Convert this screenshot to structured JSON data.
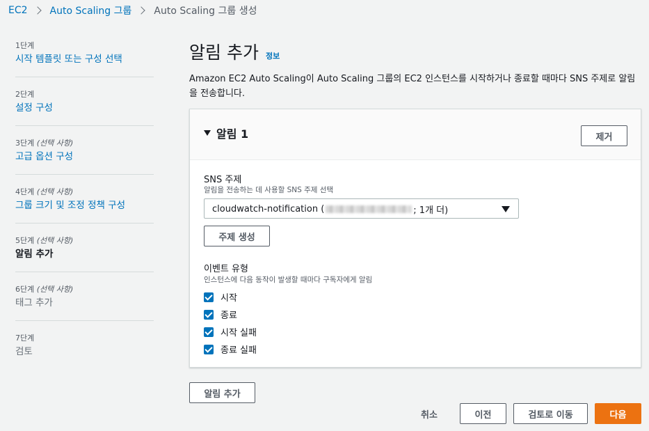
{
  "breadcrumb": {
    "items": [
      "EC2",
      "Auto Scaling 그룹"
    ],
    "current": "Auto Scaling 그룹 생성"
  },
  "steps": [
    {
      "num": "1단계",
      "optional": "",
      "label": "시작 템플릿 또는 구성 선택",
      "state": "link"
    },
    {
      "num": "2단계",
      "optional": "",
      "label": "설정 구성",
      "state": "link"
    },
    {
      "num": "3단계",
      "optional": "(선택 사항)",
      "label": "고급 옵션 구성",
      "state": "link"
    },
    {
      "num": "4단계",
      "optional": "(선택 사항)",
      "label": "그룹 크기 및 조정 정책 구성",
      "state": "link"
    },
    {
      "num": "5단계",
      "optional": "(선택 사항)",
      "label": "알림 추가",
      "state": "active"
    },
    {
      "num": "6단계",
      "optional": "(선택 사항)",
      "label": "태그 추가",
      "state": "disabled"
    },
    {
      "num": "7단계",
      "optional": "",
      "label": "검토",
      "state": "disabled"
    }
  ],
  "page": {
    "title": "알림 추가",
    "info_link": "정보",
    "description": "Amazon EC2 Auto Scaling이 Auto Scaling 그룹의 EC2 인스턴스를 시작하거나 종료할 때마다 SNS 주제로 알림을 전송합니다."
  },
  "notification": {
    "title": "알림 1",
    "remove_label": "제거",
    "sns_label": "SNS 주제",
    "sns_hint": "알림을 전송하는 데 사용할 SNS 주제 선택",
    "sns_value_prefix": "cloudwatch-notification (",
    "sns_value_suffix": "; 1개 더)",
    "create_topic_label": "주제 생성",
    "event_label": "이벤트 유형",
    "event_hint": "인스턴스에 다음 동작이 발생할 때마다 구독자에게 알림",
    "events": [
      {
        "label": "시작",
        "checked": true
      },
      {
        "label": "종료",
        "checked": true
      },
      {
        "label": "시작 실패",
        "checked": true
      },
      {
        "label": "종료 실패",
        "checked": true
      }
    ]
  },
  "actions": {
    "add_notification": "알림 추가",
    "cancel": "취소",
    "previous": "이전",
    "skip_to_review": "검토로 이동",
    "next": "다음"
  },
  "colors": {
    "link": "#0073bb",
    "primary": "#ec7211",
    "background": "#f2f3f3"
  }
}
